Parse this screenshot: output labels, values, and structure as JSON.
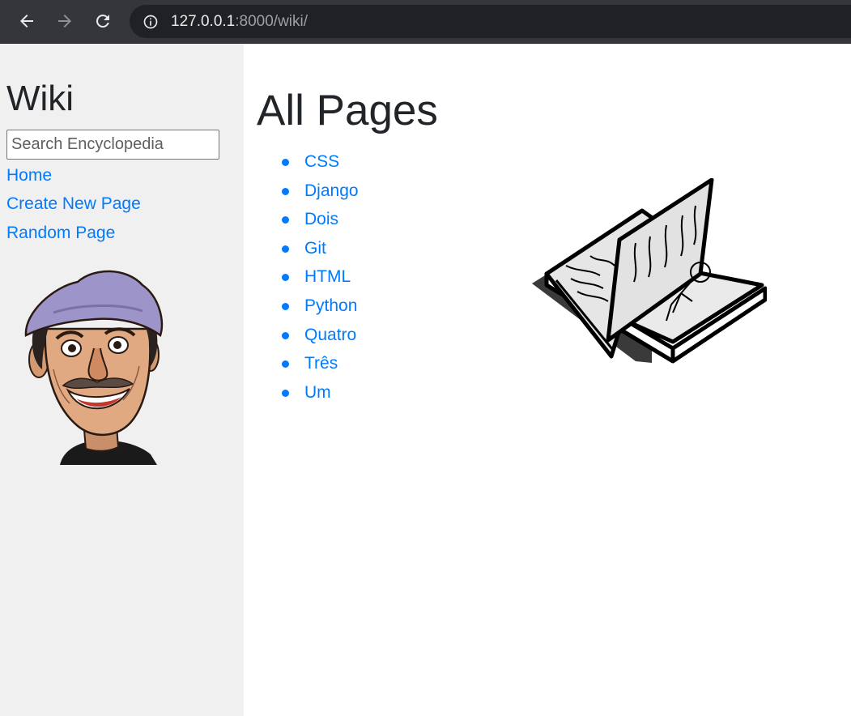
{
  "browser": {
    "url_host": "127.0.0.1",
    "url_rest": ":8000/wiki/",
    "back_icon": "arrow-left-icon",
    "forward_icon": "arrow-right-icon",
    "reload_icon": "reload-icon",
    "info_icon": "info-icon"
  },
  "sidebar": {
    "title": "Wiki",
    "search_placeholder": "Search Encyclopedia",
    "links": {
      "home": "Home",
      "create": "Create New Page",
      "random": "Random Page"
    }
  },
  "main": {
    "title": "All Pages",
    "pages": [
      "CSS",
      "Django",
      "Dois",
      "Git",
      "HTML",
      "Python",
      "Quatro",
      "Três",
      "Um"
    ]
  },
  "colors": {
    "link": "#007bff",
    "sidebar_bg": "#f0f0f0",
    "chrome_bg": "#35363a",
    "omnibox_bg": "#202124"
  }
}
